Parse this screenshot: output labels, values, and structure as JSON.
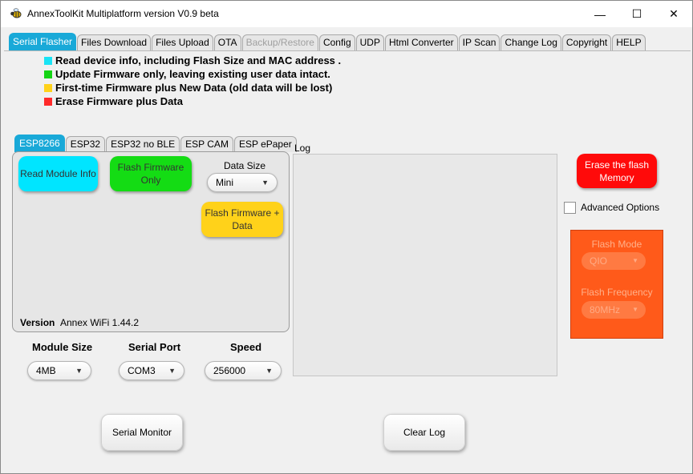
{
  "window": {
    "title": "AnnexToolKit Multiplatform version V0.9 beta",
    "controls": {
      "minimize": "—",
      "maximize": "☐",
      "close": "✕"
    }
  },
  "tabs": [
    {
      "label": "Serial Flasher",
      "active": true
    },
    {
      "label": "Files Download"
    },
    {
      "label": "Files Upload"
    },
    {
      "label": "OTA"
    },
    {
      "label": "Backup/Restore",
      "disabled": true
    },
    {
      "label": "Config"
    },
    {
      "label": "UDP"
    },
    {
      "label": "Html Converter"
    },
    {
      "label": "IP Scan"
    },
    {
      "label": "Change Log"
    },
    {
      "label": "Copyright"
    },
    {
      "label": "HELP"
    }
  ],
  "legend": [
    {
      "color": "#19e3f5",
      "text": "Read device info, including Flash Size and MAC address ."
    },
    {
      "color": "#14d414",
      "text": "Update Firmware only, leaving existing user data intact."
    },
    {
      "color": "#ffd21a",
      "text": "First-time Firmware plus New Data (old data will be lost)"
    },
    {
      "color": "#ff2a2a",
      "text": "Erase Firmware plus Data"
    }
  ],
  "esp_tabs": [
    "ESP8266",
    "ESP32",
    "ESP32 no BLE",
    "ESP CAM",
    "ESP ePaper"
  ],
  "esp_panel": {
    "read_button": "Read Module Info",
    "flash_button": "Flash Firmware Only",
    "flash_data_button": "Flash Firmware + Data",
    "data_size_label": "Data Size",
    "data_size_value": "Mini",
    "version_label": "Version",
    "version_value": "Annex WiFi 1.44.2"
  },
  "settings": {
    "module_size_label": "Module Size",
    "module_size_value": "4MB",
    "serial_port_label": "Serial Port",
    "serial_port_value": "COM3",
    "speed_label": "Speed",
    "speed_value": "256000"
  },
  "log": {
    "label": "Log"
  },
  "erase_button": "Erase the flash Memory",
  "advanced": {
    "label": "Advanced Options",
    "checked": false,
    "flash_mode_label": "Flash Mode",
    "flash_mode_value": "QIO",
    "flash_freq_label": "Flash Frequency",
    "flash_freq_value": "80MHz"
  },
  "buttons": {
    "serial_monitor": "Serial Monitor",
    "clear_log": "Clear Log"
  },
  "colors": {
    "accent": "#19a9d8",
    "read": "#00e5ff",
    "flash": "#14dc14",
    "flash_data": "#ffd21a",
    "erase": "#ff0a0a",
    "advanced_panel": "#ff5a1a"
  }
}
